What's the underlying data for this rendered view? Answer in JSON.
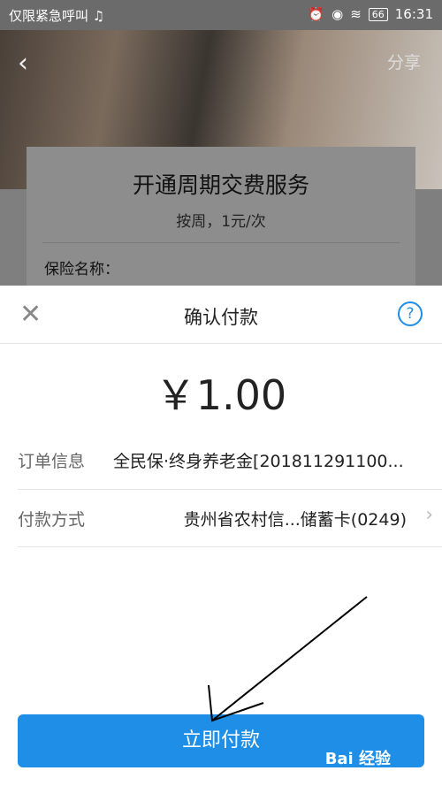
{
  "status_bar": {
    "left_text": "仅限紧急呼叫 ♫",
    "battery": "66",
    "time": "16:31"
  },
  "header": {
    "back_icon": "‹",
    "share_label": "分享"
  },
  "background_dialog": {
    "title": "开通周期交费服务",
    "subtitle": "按周，1元/次",
    "field_label": "保险名称："
  },
  "payment_sheet": {
    "close_icon": "✕",
    "title": "确认付款",
    "help_icon": "?",
    "amount": "￥1.00",
    "order_info": {
      "key": "订单信息",
      "value": "全民保·终身养老金[201811291100..."
    },
    "payment_method": {
      "key": "付款方式",
      "value": "贵州省农村信...储蓄卡(0249)"
    },
    "pay_button": "立即付款"
  },
  "watermark": "Bai 经验",
  "colors": {
    "accent": "#1e8ee6"
  }
}
